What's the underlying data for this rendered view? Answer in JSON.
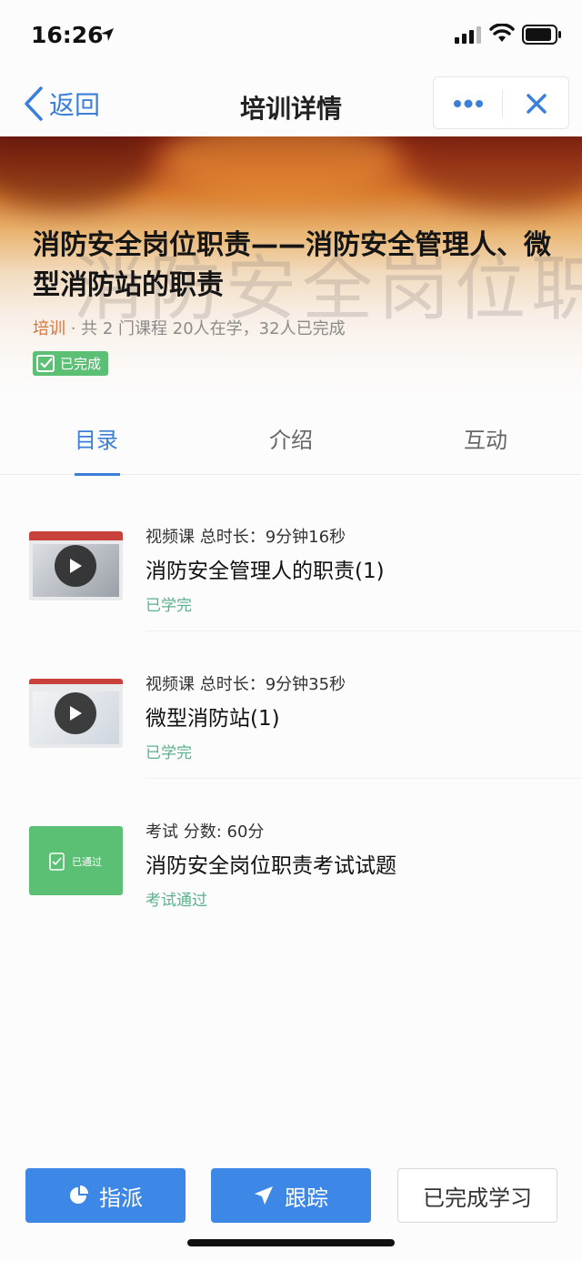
{
  "status_bar": {
    "time": "16:26"
  },
  "nav": {
    "back_label": "返回",
    "title": "培训详情"
  },
  "hero": {
    "title": "消防安全岗位职责——消防安全管理人、微型消防站的职责",
    "background_text": "消防安全岗位职责",
    "meta_tag": "培训",
    "meta_info": " · 共 2 门课程   20人在学，32人已完成",
    "badge": "已完成"
  },
  "tabs": [
    {
      "label": "目录",
      "active": true
    },
    {
      "label": "介绍",
      "active": false
    },
    {
      "label": "互动",
      "active": false
    }
  ],
  "items": [
    {
      "kind": "video",
      "type_line": "视频课  总时长：9分钟16秒",
      "name": "消防安全管理人的职责(1)",
      "status": "已学完"
    },
    {
      "kind": "video",
      "type_line": "视频课  总时长：9分钟35秒",
      "name": "微型消防站(1)",
      "status": "已学完"
    },
    {
      "kind": "exam",
      "type_line": "考试  分数: 60分",
      "name": "消防安全岗位职责考试试题",
      "status": "考试通过",
      "thumb_label": "已通过"
    }
  ],
  "bottom": {
    "assign_label": "指派",
    "track_label": "跟踪",
    "complete_label": "已完成学习"
  },
  "colors": {
    "accent": "#3d87e6",
    "success": "#5bbf74",
    "tag": "#d9743a"
  }
}
